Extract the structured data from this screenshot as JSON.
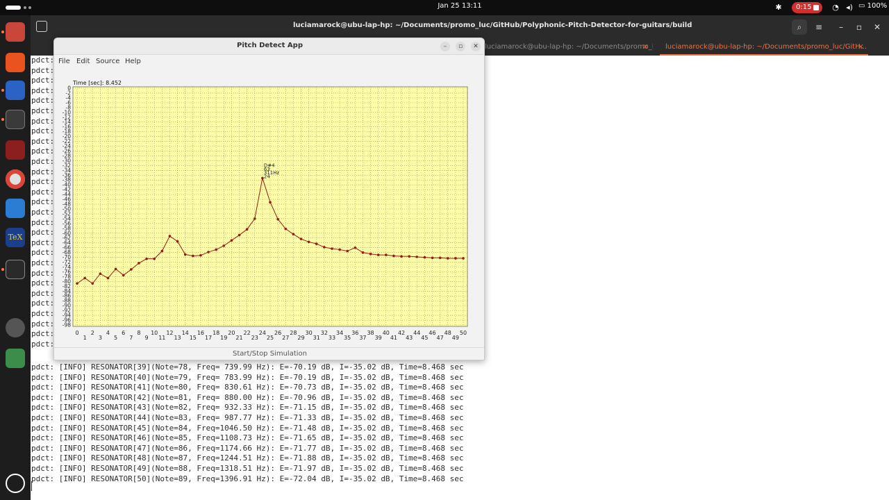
{
  "topbar": {
    "clock": "Jan 25  13:11",
    "recording_time": "0:15",
    "battery": "100%"
  },
  "terminal": {
    "window_title": "luciamarock@ubu-lap-hp: ~/Documents/promo_luc/GitHub/Polyphonic-Pitch-Detector-for-guitars/build",
    "tabs": [
      "luciamarock@ubu-lap-hp: ~/Documents/promo_luc/GitH...",
      "luciamarock@ubu-lap-hp: ~/Documents/promo_luc/GitH..."
    ],
    "hidden_prefix": "pdct:",
    "lines": [
      "pdct: [INFO] RESONATOR[39](Note=78, Freq= 739.99 Hz): E=-70.19 dB, I=-35.02 dB, Time=8.468 sec",
      "pdct: [INFO] RESONATOR[40](Note=79, Freq= 783.99 Hz): E=-70.19 dB, I=-35.02 dB, Time=8.468 sec",
      "pdct: [INFO] RESONATOR[41](Note=80, Freq= 830.61 Hz): E=-70.73 dB, I=-35.02 dB, Time=8.468 sec",
      "pdct: [INFO] RESONATOR[42](Note=81, Freq= 880.00 Hz): E=-70.96 dB, I=-35.02 dB, Time=8.468 sec",
      "pdct: [INFO] RESONATOR[43](Note=82, Freq= 932.33 Hz): E=-71.15 dB, I=-35.02 dB, Time=8.468 sec",
      "pdct: [INFO] RESONATOR[44](Note=83, Freq= 987.77 Hz): E=-71.33 dB, I=-35.02 dB, Time=8.468 sec",
      "pdct: [INFO] RESONATOR[45](Note=84, Freq=1046.50 Hz): E=-71.48 dB, I=-35.02 dB, Time=8.468 sec",
      "pdct: [INFO] RESONATOR[46](Note=85, Freq=1108.73 Hz): E=-71.65 dB, I=-35.02 dB, Time=8.468 sec",
      "pdct: [INFO] RESONATOR[47](Note=86, Freq=1174.66 Hz): E=-71.77 dB, I=-35.02 dB, Time=8.468 sec",
      "pdct: [INFO] RESONATOR[48](Note=87, Freq=1244.51 Hz): E=-71.88 dB, I=-35.02 dB, Time=8.468 sec",
      "pdct: [INFO] RESONATOR[49](Note=88, Freq=1318.51 Hz): E=-71.97 dB, I=-35.02 dB, Time=8.468 sec",
      "pdct: [INFO] RESONATOR[50](Note=89, Freq=1396.91 Hz): E=-72.04 dB, I=-35.02 dB, Time=8.468 sec"
    ]
  },
  "app": {
    "title": "Pitch Detect App",
    "menu": [
      "File",
      "Edit",
      "Source",
      "Help"
    ],
    "footer_button": "Start/Stop Simulation"
  },
  "chart_data": {
    "type": "line",
    "title": "Time [sec]: 8.452",
    "xlabel": "",
    "ylabel": "",
    "xlim": [
      0,
      50
    ],
    "ylim": [
      -98,
      0
    ],
    "yticks_step": 2,
    "grid": true,
    "background": "#ffffa8",
    "line_color": "#a01414",
    "x": [
      0,
      1,
      2,
      3,
      4,
      5,
      6,
      7,
      8,
      9,
      10,
      11,
      12,
      13,
      14,
      15,
      16,
      17,
      18,
      19,
      20,
      21,
      22,
      23,
      24,
      25,
      26,
      27,
      28,
      29,
      30,
      31,
      32,
      33,
      34,
      35,
      36,
      37,
      38,
      39,
      40,
      41,
      42,
      43,
      44,
      45,
      46,
      47,
      48,
      49,
      50
    ],
    "values": [
      -80.8,
      -78.6,
      -80.8,
      -76.8,
      -78.6,
      -74.8,
      -77.4,
      -75.0,
      -72.4,
      -70.6,
      -70.6,
      -67.4,
      -61.2,
      -63.4,
      -68.8,
      -69.4,
      -69.2,
      -67.8,
      -66.8,
      -65.2,
      -63.0,
      -60.8,
      -58.4,
      -54.0,
      -37.2,
      -47.2,
      -54.2,
      -58.2,
      -60.4,
      -62.4,
      -63.6,
      -64.4,
      -65.8,
      -66.4,
      -66.8,
      -67.4,
      -66.0,
      -68.0,
      -68.6,
      -69.0,
      -69.0,
      -69.4,
      -69.6,
      -69.6,
      -69.8,
      -70.0,
      -70.2,
      -70.2,
      -70.4,
      -70.4,
      -70.4
    ],
    "annotation": {
      "x": 24,
      "lines": [
        "D#4",
        "63",
        "311Hz",
        "24"
      ]
    }
  }
}
